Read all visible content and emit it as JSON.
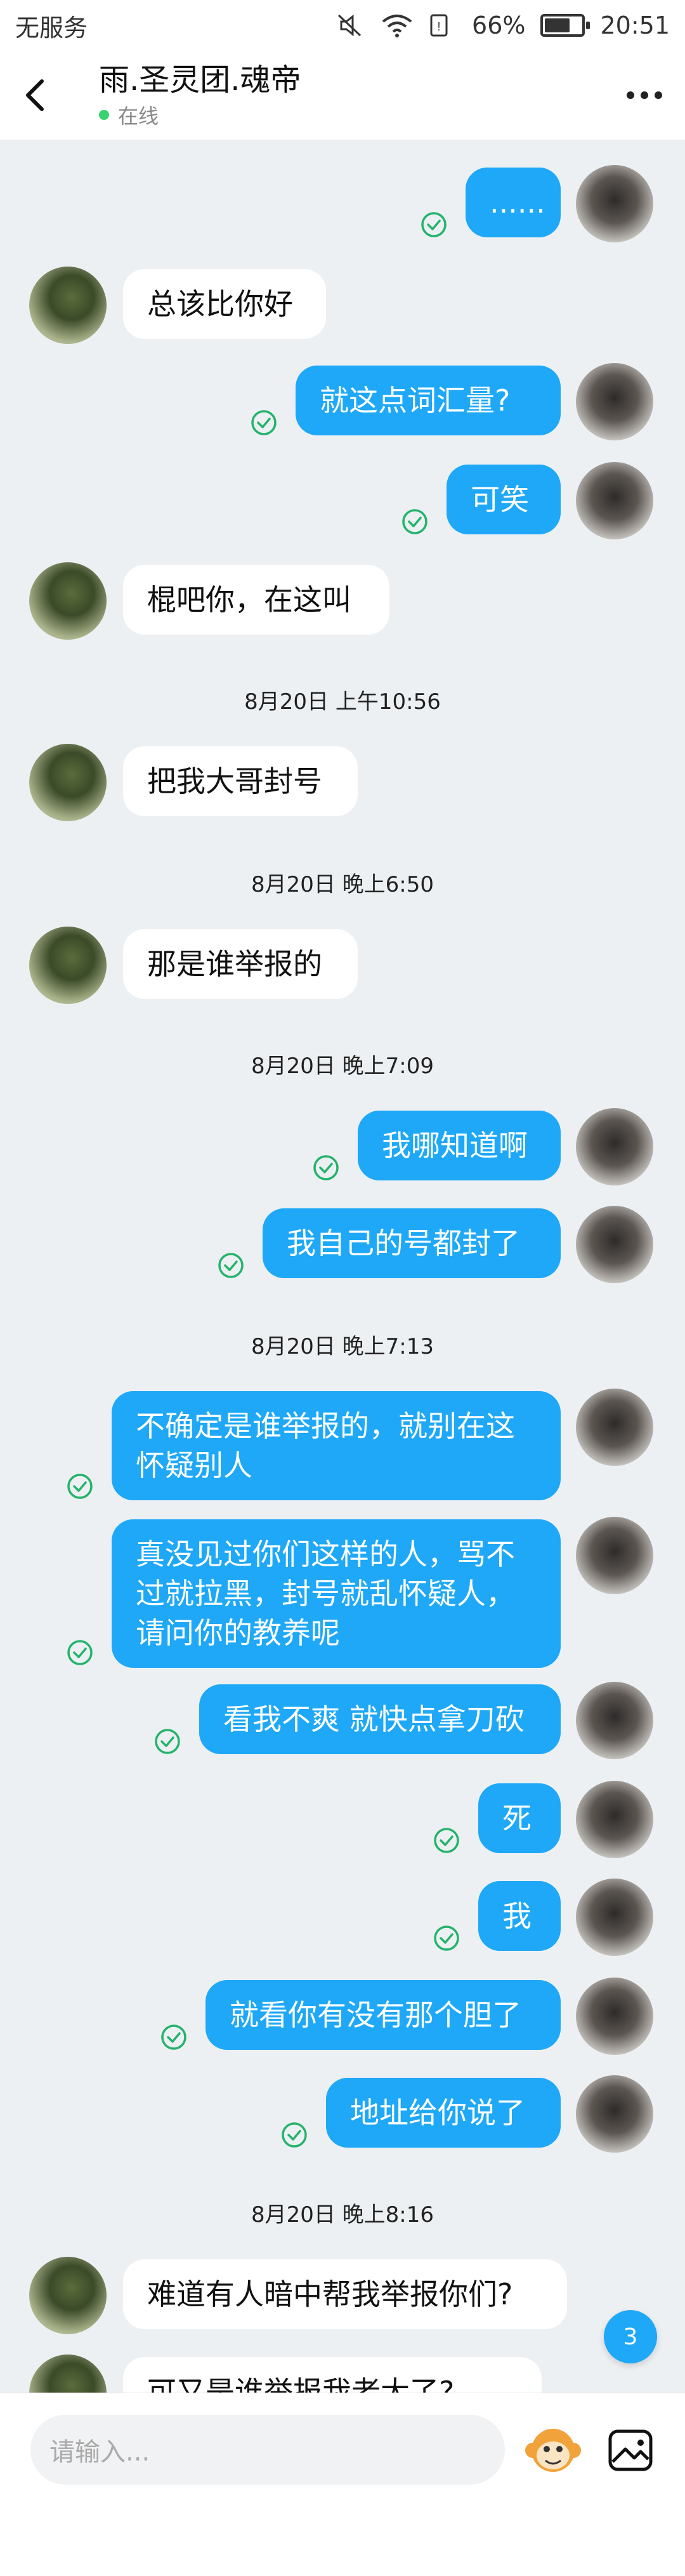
{
  "status_bar": {
    "carrier": "无服务",
    "battery": "66%",
    "battery_level": 0.66,
    "time": "20:51"
  },
  "header": {
    "title": "雨.圣灵团.魂帝",
    "status": "在线"
  },
  "messages": [
    {
      "side": "out",
      "text": "......"
    },
    {
      "side": "in",
      "text": "总该比你好"
    },
    {
      "side": "out",
      "text": "就这点词汇量?"
    },
    {
      "side": "out",
      "text": "可笑"
    },
    {
      "side": "in",
      "text": "棍吧你，在这叫"
    },
    {
      "timestamp": "8月20日 上午10:56"
    },
    {
      "side": "in",
      "text": "把我大哥封号"
    },
    {
      "timestamp": "8月20日 晚上6:50"
    },
    {
      "side": "in",
      "text": "那是谁举报的"
    },
    {
      "timestamp": "8月20日 晚上7:09"
    },
    {
      "side": "out",
      "text": "我哪知道啊"
    },
    {
      "side": "out",
      "text": "我自己的号都封了"
    },
    {
      "timestamp": "8月20日 晚上7:13"
    },
    {
      "side": "out",
      "lines": [
        "不确定是谁举报的，就别在这",
        "怀疑别人"
      ]
    },
    {
      "side": "out",
      "lines": [
        "真没见过你们这样的人，骂不",
        "过就拉黑，封号就乱怀疑人，",
        "请问你的教养呢"
      ]
    },
    {
      "side": "out",
      "text": "看我不爽 就快点拿刀砍"
    },
    {
      "side": "out",
      "text": "死"
    },
    {
      "side": "out",
      "text": "我"
    },
    {
      "side": "out",
      "text": "就看你有没有那个胆了"
    },
    {
      "side": "out",
      "text": "地址给你说了"
    },
    {
      "timestamp": "8月20日 晚上8:16"
    },
    {
      "side": "in",
      "text": "难道有人暗中帮我举报你们?"
    },
    {
      "side": "in",
      "text": "可又是谁举报我老大了?"
    }
  ],
  "unread_badge": "3",
  "input": {
    "placeholder": "请输入..."
  },
  "icons": {
    "back": "chevron-left-icon",
    "more": "more-dots-icon",
    "read": "check-circle-icon",
    "emoji": "emoji-monkey-icon",
    "image": "image-icon"
  },
  "colors": {
    "outgoing_bubble": "#1ea8f7",
    "online_dot": "#3bd16f",
    "check": "#24b36b"
  }
}
